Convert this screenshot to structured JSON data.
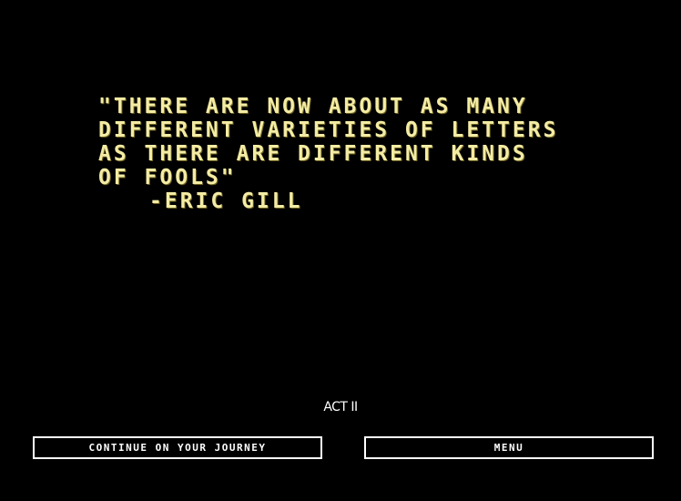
{
  "quote": {
    "lines": [
      "\"THERE ARE NOW ABOUT AS MANY",
      "DIFFERENT VARIETIES OF LETTERS",
      "AS THERE ARE DIFFERENT KINDS",
      "OF FOOLS\""
    ],
    "attribution": "-ERIC GILL",
    "text_color": "#f4eca4"
  },
  "act_label": "ACT II",
  "buttons": {
    "continue_label": "CONTINUE ON YOUR JOURNEY",
    "menu_label": "MENU"
  },
  "colors": {
    "background": "#000000",
    "button_border": "#ffffff"
  }
}
